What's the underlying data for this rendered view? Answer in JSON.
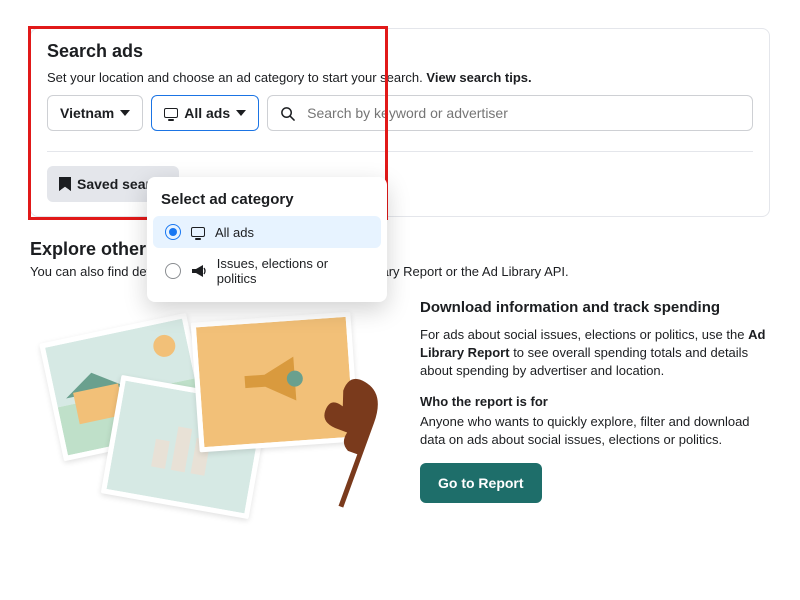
{
  "search": {
    "heading": "Search ads",
    "subtext_prefix": "Set your location and choose an ad category to start your search. ",
    "subtext_link": "View search tips.",
    "location_label": "Vietnam",
    "category_label": "All ads",
    "search_placeholder": "Search by keyword or advertiser",
    "saved_label": "Saved search"
  },
  "popover": {
    "title": "Select ad category",
    "options": [
      {
        "label": "All ads",
        "selected": true,
        "icon": "monitor"
      },
      {
        "label": "Issues, elections or politics",
        "selected": false,
        "icon": "megaphone"
      }
    ]
  },
  "explore": {
    "heading": "Explore other tools",
    "subtext": "You can also find detailed ad information by using the Ad Library Report or the Ad Library API."
  },
  "tool": {
    "heading": "Download information and track spending",
    "body_prefix": "For ads about social issues, elections or politics, use the ",
    "body_bold": "Ad Library Report",
    "body_suffix": " to see overall spending totals and details about spending by advertiser and location.",
    "who_label": "Who the report is for",
    "who_body": "Anyone who wants to quickly explore, filter and download data on ads about social issues, elections or politics.",
    "button": "Go to Report"
  },
  "colors": {
    "highlight": "#e11919",
    "accent_blue": "#1877f2",
    "report_btn": "#1e6e6a"
  }
}
